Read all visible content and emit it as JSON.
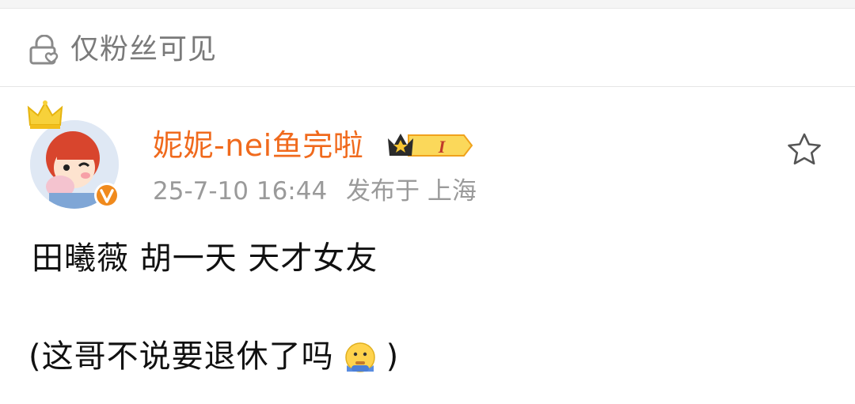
{
  "visibility": {
    "icon": "lock-heart-icon",
    "label": "仅粉丝可见"
  },
  "post": {
    "author": {
      "name": "妮妮-nei鱼完啦",
      "avatar": "avatar-icon",
      "vip_badge_text": "I",
      "verified": true
    },
    "meta": {
      "timestamp": "25-7-10 16:44",
      "location_label": "发布于 上海"
    },
    "content": {
      "line1": "田曦薇 胡一天 天才女友",
      "line2_prefix": "(这哥不说要退休了吗",
      "line2_emoji": "thinking-face-icon",
      "line2_suffix": ")"
    },
    "favorite_icon": "star-outline-icon"
  },
  "colors": {
    "username": "#f06a1d",
    "meta": "#9a9a9a",
    "text": "#111111",
    "badge_orange": "#f08a1d"
  }
}
